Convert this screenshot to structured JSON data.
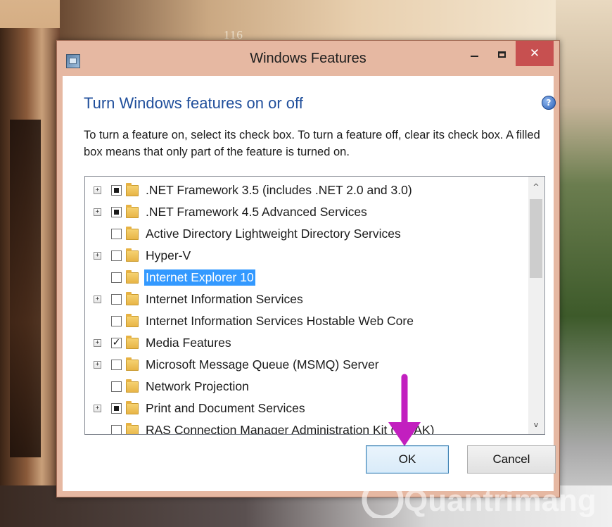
{
  "background": {
    "building_number": "116"
  },
  "window": {
    "title": "Windows Features",
    "close_glyph": "✕",
    "heading": "Turn Windows features on or off",
    "help_glyph": "?",
    "description": "To turn a feature on, select its check box. To turn a feature off, clear its check box. A filled box means that only part of the feature is turned on."
  },
  "features": [
    {
      "label": ".NET Framework 3.5 (includes .NET 2.0 and 3.0)",
      "expandable": true,
      "state": "partial",
      "selected": false
    },
    {
      "label": ".NET Framework 4.5 Advanced Services",
      "expandable": true,
      "state": "partial",
      "selected": false
    },
    {
      "label": "Active Directory Lightweight Directory Services",
      "expandable": false,
      "state": "unchecked",
      "selected": false
    },
    {
      "label": "Hyper-V",
      "expandable": true,
      "state": "unchecked",
      "selected": false
    },
    {
      "label": "Internet Explorer 10",
      "expandable": false,
      "state": "unchecked",
      "selected": true
    },
    {
      "label": "Internet Information Services",
      "expandable": true,
      "state": "unchecked",
      "selected": false
    },
    {
      "label": "Internet Information Services Hostable Web Core",
      "expandable": false,
      "state": "unchecked",
      "selected": false
    },
    {
      "label": "Media Features",
      "expandable": true,
      "state": "checked",
      "selected": false
    },
    {
      "label": "Microsoft Message Queue (MSMQ) Server",
      "expandable": true,
      "state": "unchecked",
      "selected": false
    },
    {
      "label": "Network Projection",
      "expandable": false,
      "state": "unchecked",
      "selected": false
    },
    {
      "label": "Print and Document Services",
      "expandable": true,
      "state": "partial",
      "selected": false
    },
    {
      "label": "RAS Connection Manager Administration Kit (CMAK)",
      "expandable": false,
      "state": "unchecked",
      "selected": false
    }
  ],
  "glyphs": {
    "expander": "+",
    "check": "✓",
    "scroll_up": "^",
    "scroll_down": "v"
  },
  "buttons": {
    "ok": "OK",
    "cancel": "Cancel"
  },
  "watermark": {
    "text": "Quantrimang"
  },
  "colors": {
    "titlebar": "#e6b8a2",
    "close_button": "#c75050",
    "heading": "#1f4e9b",
    "selection": "#3399ff",
    "annotation_arrow": "#c21fbf"
  }
}
